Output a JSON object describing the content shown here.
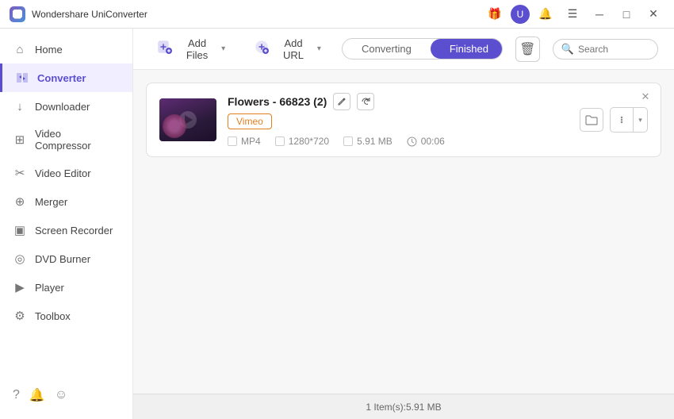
{
  "titlebar": {
    "app_name": "Wondershare UniConverter",
    "icons": {
      "gift": "🎁",
      "avatar": "U",
      "bell": "🔔",
      "menu": "☰",
      "minimize": "─",
      "maximize": "□",
      "close": "✕"
    }
  },
  "sidebar": {
    "items": [
      {
        "id": "home",
        "label": "Home",
        "icon": "⌂",
        "active": false
      },
      {
        "id": "converter",
        "label": "Converter",
        "icon": "⇄",
        "active": true
      },
      {
        "id": "downloader",
        "label": "Downloader",
        "icon": "↓",
        "active": false
      },
      {
        "id": "video-compressor",
        "label": "Video Compressor",
        "icon": "⊞",
        "active": false
      },
      {
        "id": "video-editor",
        "label": "Video Editor",
        "icon": "✂",
        "active": false
      },
      {
        "id": "merger",
        "label": "Merger",
        "icon": "⊕",
        "active": false
      },
      {
        "id": "screen-recorder",
        "label": "Screen Recorder",
        "icon": "▣",
        "active": false
      },
      {
        "id": "dvd-burner",
        "label": "DVD Burner",
        "icon": "◎",
        "active": false
      },
      {
        "id": "player",
        "label": "Player",
        "icon": "▶",
        "active": false
      },
      {
        "id": "toolbox",
        "label": "Toolbox",
        "icon": "⚙",
        "active": false
      }
    ],
    "footer": {
      "help_icon": "?",
      "bell_icon": "🔔",
      "feedback_icon": "☺"
    }
  },
  "toolbar": {
    "add_file_label": "Add Files",
    "add_file_icon": "📄",
    "add_url_label": "Add URL",
    "add_url_icon": "🔗",
    "tabs": {
      "converting_label": "Converting",
      "finished_label": "Finished",
      "active": "finished"
    },
    "search_placeholder": "Search",
    "delete_icon": "🗑"
  },
  "file_list": {
    "items": [
      {
        "id": "flowers-66823",
        "name": "Flowers - 66823 (2)",
        "source": "Vimeo",
        "format": "MP4",
        "resolution": "1280*720",
        "size": "5.91 MB",
        "duration": "00:06",
        "thumb_color": "#2a1a3a"
      }
    ]
  },
  "status_bar": {
    "text": "1 Item(s):5.91 MB"
  }
}
